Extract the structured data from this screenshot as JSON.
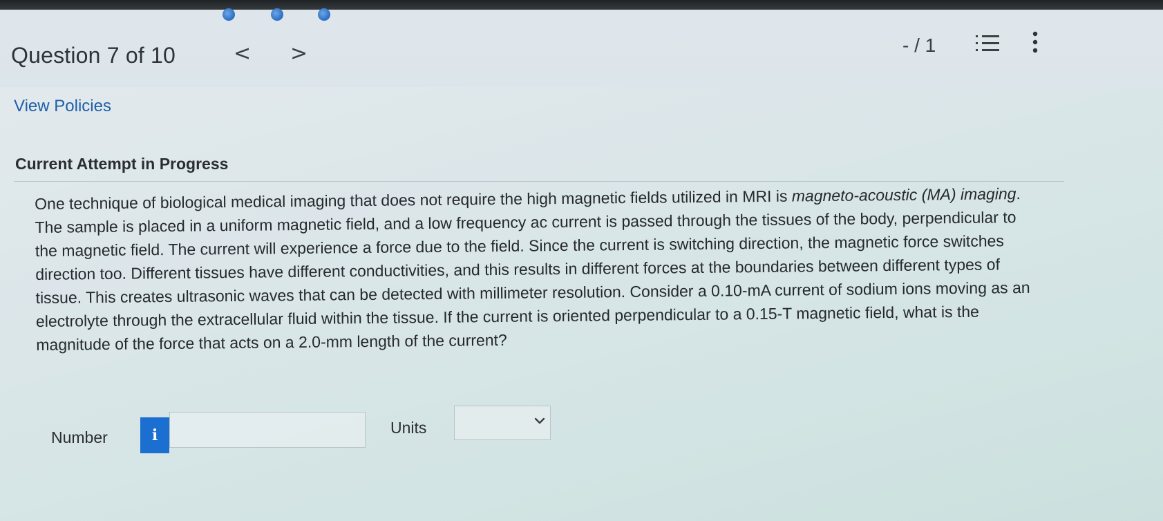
{
  "header": {
    "title": "Question 7 of 10",
    "prev_icon": "chevron-left-icon",
    "next_icon": "chevron-right-icon",
    "prev_glyph": "<",
    "next_glyph": ">",
    "score": "- / 1",
    "list_icon": "list-icon",
    "more_icon": "more-vertical-icon"
  },
  "links": {
    "view_policies": "View Policies"
  },
  "attempt": {
    "heading": "Current Attempt in Progress"
  },
  "question": {
    "text_plain_1": "One technique of biological medical imaging that does not require the high magnetic fields utilized in MRI is ",
    "text_italic": "magneto-acoustic (MA) imaging",
    "text_plain_2": ". The sample is placed in a uniform magnetic field, and a low frequency ac current is passed through the tissues of the body, perpendicular to the magnetic field. The current will experience a force due to the field. Since the current is switching direction, the magnetic force switches direction too. Different tissues have different conductivities, and this results in different forces at the boundaries between different types of tissue. This creates ultrasonic waves that can be detected with millimeter resolution. Consider a 0.10-mA current of sodium ions moving as an electrolyte through the extracellular fluid within the tissue. If the current is oriented perpendicular to a 0.15-T magnetic field, what is the magnitude of the force that acts on a 2.0-mm length of the current?"
  },
  "answer": {
    "number_label": "Number",
    "info_glyph": "i",
    "info_icon": "info-icon",
    "number_value": "",
    "units_label": "Units",
    "units_value": "",
    "units_icon": "chevron-down-icon"
  },
  "colors": {
    "link": "#1f5fa8",
    "info_button": "#1b6fd1",
    "loading_dots": "#2a6cc0"
  }
}
